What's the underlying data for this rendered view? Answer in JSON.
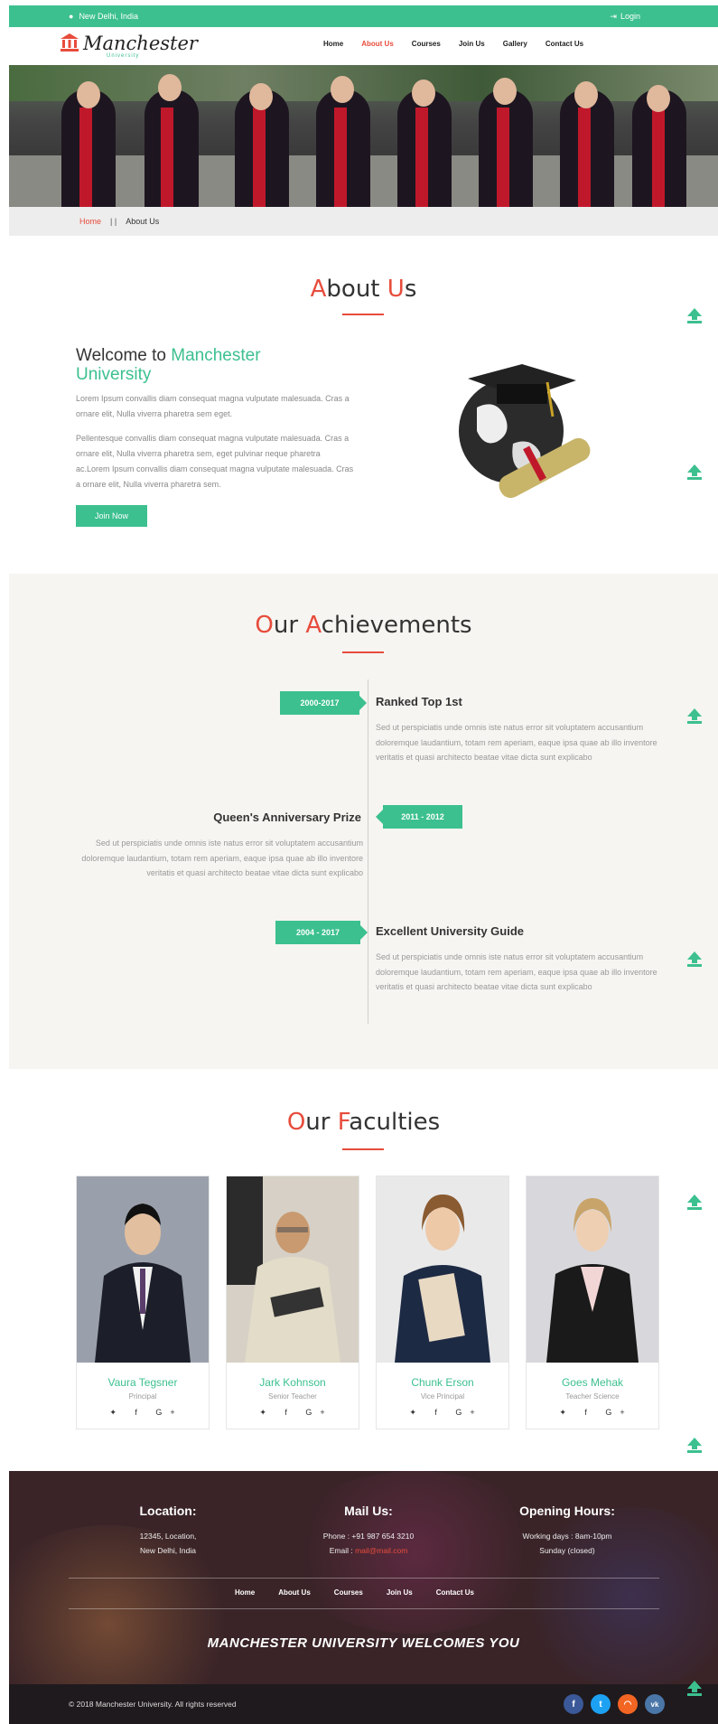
{
  "topbar": {
    "location": "New Delhi, India",
    "login": "Login"
  },
  "brand": {
    "name": "Manchester",
    "sub": "University"
  },
  "nav": [
    {
      "label": "Home"
    },
    {
      "label": "About Us",
      "active": true
    },
    {
      "label": "Courses"
    },
    {
      "label": "Join Us"
    },
    {
      "label": "Gallery"
    },
    {
      "label": "Contact Us"
    }
  ],
  "breadcrumb": {
    "home": "Home",
    "separator": "| |",
    "current": "About Us"
  },
  "about": {
    "title_first_letter": "A",
    "title_rest_1": "bout ",
    "title_second_letter": "U",
    "title_rest_2": "s",
    "welcome_prefix": "Welcome to ",
    "welcome_highlight_1": "Manchester",
    "welcome_highlight_2": "University",
    "para1": "Lorem Ipsum convallis diam consequat magna vulputate malesuada. Cras a ornare elit, Nulla viverra pharetra sem eget.",
    "para2": "Pellentesque convallis diam consequat magna vulputate malesuada. Cras a ornare elit, Nulla viverra pharetra sem, eget pulvinar neque pharetra ac.Lorem Ipsum convallis diam consequat magna vulputate malesuada. Cras a ornare elit, Nulla viverra pharetra sem.",
    "join_button": "Join Now"
  },
  "achievements": {
    "title_first_letter": "O",
    "title_rest_1": "ur ",
    "title_second_letter": "A",
    "title_rest_2": "chievements",
    "items": [
      {
        "years": "2000-2017",
        "title": "Ranked Top 1st",
        "text": "Sed ut perspiciatis unde omnis iste natus error sit voluptatem accusantium doloremque laudantium, totam rem aperiam, eaque ipsa quae ab illo inventore veritatis et quasi architecto beatae vitae dicta sunt explicabo"
      },
      {
        "years": "2011 - 2012",
        "title": "Queen's Anniversary Prize",
        "text": "Sed ut perspiciatis unde omnis iste natus error sit voluptatem accusantium doloremque laudantium, totam rem aperiam, eaque ipsa quae ab illo inventore veritatis et quasi architecto beatae vitae dicta sunt explicabo"
      },
      {
        "years": "2004 - 2017",
        "title": "Excellent University Guide",
        "text": "Sed ut perspiciatis unde omnis iste natus error sit voluptatem accusantium doloremque laudantium, totam rem aperiam, eaque ipsa quae ab illo inventore veritatis et quasi architecto beatae vitae dicta sunt explicabo"
      }
    ]
  },
  "faculties": {
    "title_first_letter": "O",
    "title_rest_1": "ur ",
    "title_second_letter": "F",
    "title_rest_2": "aculties",
    "members": [
      {
        "name": "Vaura Tegsner",
        "role": "Principal"
      },
      {
        "name": "Jark Kohnson",
        "role": "Senior Teacher"
      },
      {
        "name": "Chunk Erson",
        "role": "Vice Principal"
      },
      {
        "name": "Goes Mehak",
        "role": "Teacher Science"
      }
    ],
    "social_glyphs": "✦ f G+"
  },
  "footer": {
    "location_title": "Location:",
    "location_line1": "12345, Location,",
    "location_line2": "New Delhi, India",
    "mail_title": "Mail Us:",
    "phone": "Phone : +91 987 654 3210",
    "email_label": "Email : ",
    "email": "mail@mail.com",
    "hours_title": "Opening Hours:",
    "hours_line1": "Working days : 8am-10pm",
    "hours_line2": "Sunday (closed)",
    "nav": [
      "Home",
      "About Us",
      "Courses",
      "Join Us",
      "Contact Us"
    ],
    "welcome": "MANCHESTER UNIVERSITY WELCOMES YOU",
    "copyright": "© 2018 Manchester University. All rights reserved",
    "social": [
      "f",
      "t",
      "rss",
      "vk"
    ]
  },
  "colors": {
    "accent": "#3cc08f",
    "red": "#e74c3c"
  }
}
